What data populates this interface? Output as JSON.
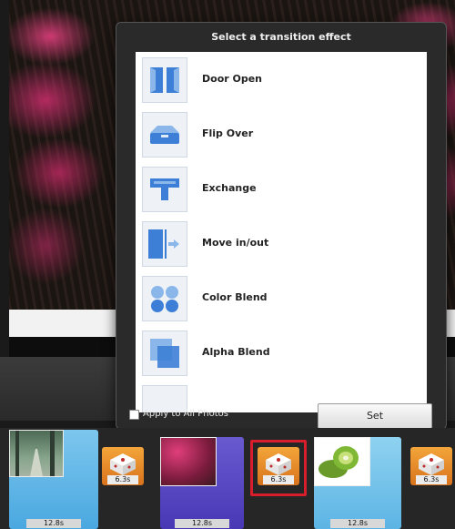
{
  "popup": {
    "title": "Select a transition effect",
    "apply_all_label": "Apply to All Photos",
    "apply_all_checked": false,
    "set_label": "Set"
  },
  "effects": [
    {
      "label": "Door Open",
      "icon": "door-open-icon"
    },
    {
      "label": "Flip Over",
      "icon": "flip-over-icon"
    },
    {
      "label": "Exchange",
      "icon": "exchange-icon"
    },
    {
      "label": "Move in/out",
      "icon": "move-in-out-icon"
    },
    {
      "label": "Color Blend",
      "icon": "color-blend-icon"
    },
    {
      "label": "Alpha Blend",
      "icon": "alpha-blend-icon"
    }
  ],
  "filmstrip": {
    "photos": [
      {
        "name": "forest-road",
        "duration": "12.8s"
      },
      {
        "name": "pink-trees",
        "duration": "12.8s"
      },
      {
        "name": "kiwi",
        "duration": "12.8s"
      }
    ],
    "transitions": [
      {
        "duration": "6.3s",
        "selected": false
      },
      {
        "duration": "6.3s",
        "selected": true
      },
      {
        "duration": "6.3s",
        "selected": false
      }
    ]
  },
  "colors": {
    "accent_blue": "#3d7fd6",
    "transition_orange": "#e8892a",
    "selected_red": "#d81e2c"
  }
}
